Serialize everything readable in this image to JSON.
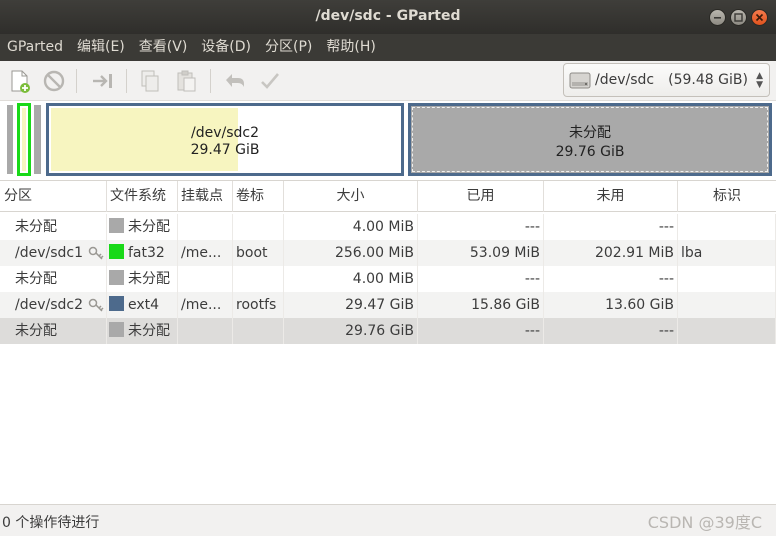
{
  "window": {
    "title": "/dev/sdc - GParted"
  },
  "menu": [
    "GParted",
    "编辑(E)",
    "查看(V)",
    "设备(D)",
    "分区(P)",
    "帮助(H)"
  ],
  "toolbar": {
    "icons": [
      "new-partition-icon",
      "delete-icon",
      "resize-move-icon",
      "copy-icon",
      "paste-icon",
      "undo-icon",
      "apply-icon"
    ]
  },
  "device": {
    "name": "/dev/sdc",
    "size": "(59.48 GiB)"
  },
  "diskmap": {
    "partition_name": "/dev/sdc2",
    "partition_size": "29.47 GiB",
    "partition_used_fraction": 0.54,
    "unallocated_label": "未分配",
    "unallocated_size": "29.76 GiB"
  },
  "table": {
    "headers": [
      "分区",
      "文件系统",
      "挂载点",
      "卷标",
      "大小",
      "已用",
      "未用",
      "标识"
    ],
    "rows": [
      {
        "partition": "未分配",
        "fs": "未分配",
        "fs_color": "#a9a9a9",
        "mount": "",
        "label": "",
        "size": "4.00 MiB",
        "used": "---",
        "unused": "---",
        "flags": "",
        "locked": false
      },
      {
        "partition": "/dev/sdc1",
        "fs": "fat32",
        "fs_color": "#18d918",
        "mount": "/me...",
        "label": "boot",
        "size": "256.00 MiB",
        "used": "53.09 MiB",
        "unused": "202.91 MiB",
        "flags": "lba",
        "locked": true
      },
      {
        "partition": "未分配",
        "fs": "未分配",
        "fs_color": "#a9a9a9",
        "mount": "",
        "label": "",
        "size": "4.00 MiB",
        "used": "---",
        "unused": "---",
        "flags": "",
        "locked": false
      },
      {
        "partition": "/dev/sdc2",
        "fs": "ext4",
        "fs_color": "#4d6a8c",
        "mount": "/me...",
        "label": "rootfs",
        "size": "29.47 GiB",
        "used": "15.86 GiB",
        "unused": "13.60 GiB",
        "flags": "",
        "locked": true
      },
      {
        "partition": "未分配",
        "fs": "未分配",
        "fs_color": "#a9a9a9",
        "mount": "",
        "label": "",
        "size": "29.76 GiB",
        "used": "---",
        "unused": "---",
        "flags": "",
        "locked": false
      }
    ]
  },
  "status": {
    "text": "0 个操作待进行"
  },
  "watermark": "CSDN @39度C",
  "colors": {
    "unallocated": "#a9a9a9",
    "fat32": "#18d918",
    "ext4": "#4d6a8c",
    "used_fill": "#f7f5c0"
  }
}
